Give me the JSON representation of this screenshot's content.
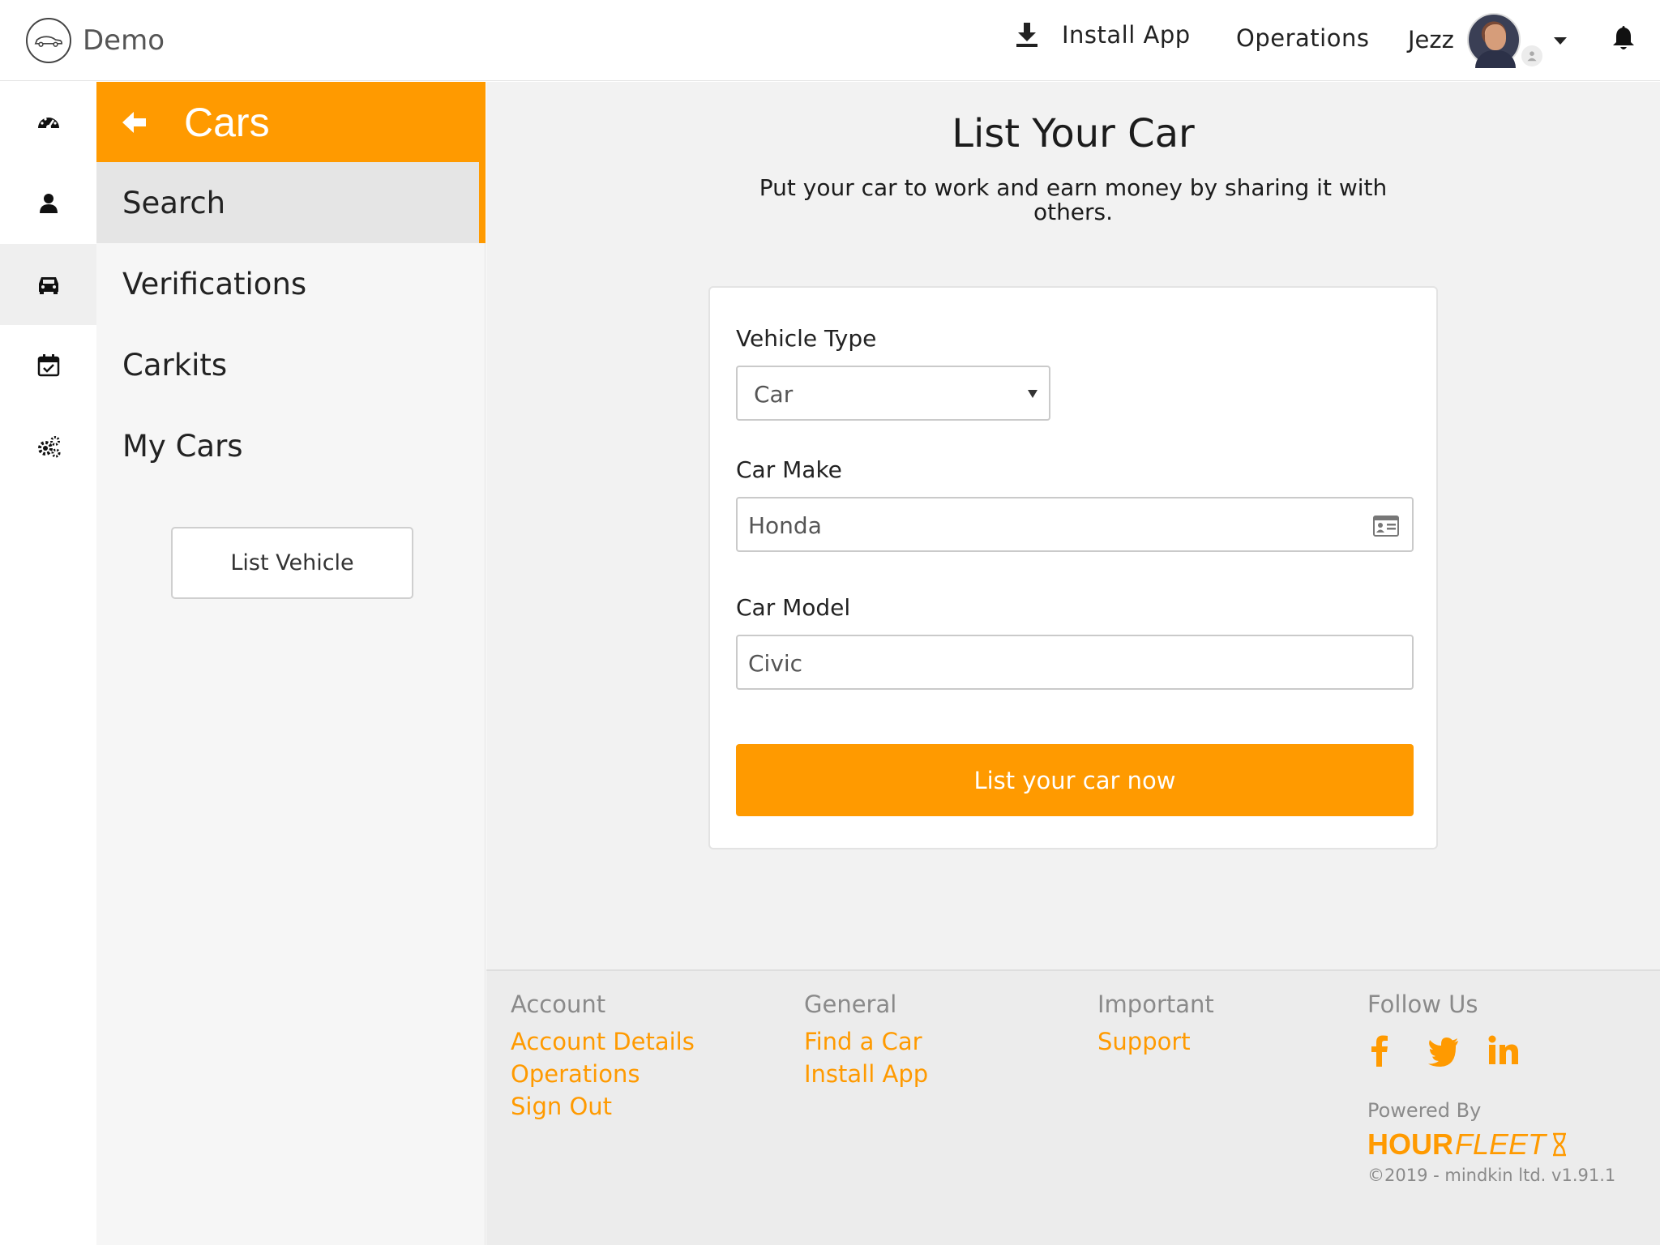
{
  "app": {
    "brand": "Demo"
  },
  "header": {
    "install_label": "Install App",
    "operations_label": "Operations",
    "user_name": "Jezz"
  },
  "rail": {
    "items": [
      {
        "icon": "dashboard-icon"
      },
      {
        "icon": "user-icon"
      },
      {
        "icon": "car-icon",
        "active": true
      },
      {
        "icon": "calendar-check-icon"
      },
      {
        "icon": "gears-icon"
      }
    ]
  },
  "submenu": {
    "title": "Cars",
    "items": [
      {
        "label": "Search",
        "active": true
      },
      {
        "label": "Verifications"
      },
      {
        "label": "Carkits"
      },
      {
        "label": "My Cars"
      }
    ],
    "list_vehicle_label": "List Vehicle"
  },
  "main": {
    "title": "List Your Car",
    "subtitle": "Put your car to work and earn money by sharing it with others.",
    "form": {
      "vehicle_type_label": "Vehicle Type",
      "vehicle_type_value": "Car",
      "car_make_label": "Car Make",
      "car_make_value": "Honda",
      "car_model_label": "Car Model",
      "car_model_value": "Civic",
      "submit_label": "List your car now"
    }
  },
  "footer": {
    "account": {
      "heading": "Account",
      "links": [
        "Account Details",
        "Operations",
        "Sign Out"
      ]
    },
    "general": {
      "heading": "General",
      "links": [
        "Find a Car",
        "Install App"
      ]
    },
    "important": {
      "heading": "Important",
      "links": [
        "Support"
      ]
    },
    "follow": {
      "heading": "Follow Us",
      "icons": [
        "facebook-icon",
        "twitter-icon",
        "linkedin-icon"
      ]
    },
    "powered_by": "Powered By",
    "logo_hour": "HOUR",
    "logo_fleet": "FLEET",
    "copyright": "©2019 - mindkin ltd. v1.91.1"
  },
  "colors": {
    "accent": "#ff9a00",
    "main_bg": "#f2f2f2",
    "submenu_bg": "#f6f6f6"
  }
}
